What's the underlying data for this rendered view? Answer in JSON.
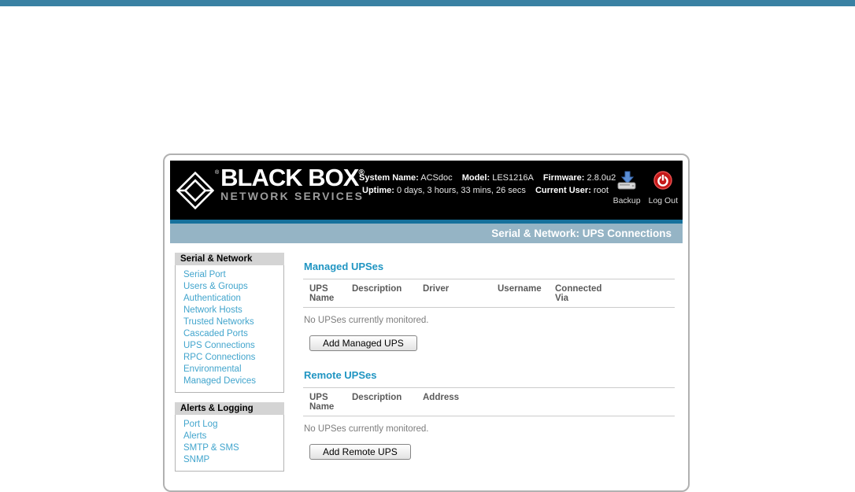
{
  "colors": {
    "topbar": "#3a81a3",
    "banner": "#95b4c5",
    "teal_strip": "#16719c",
    "heading_blue": "#2095c2",
    "link_blue": "#42a5cd",
    "logout_red": "#c41818"
  },
  "header": {
    "brand": {
      "name": "BLACK BOX",
      "reg": "®",
      "tagline": "NETWORK SERVICES",
      "diamond_icon": "brand-diamond-icon"
    },
    "info_line1": [
      {
        "label": "System Name:",
        "value": "ACSdoc"
      },
      {
        "label": "Model:",
        "value": "LES1216A"
      },
      {
        "label": "Firmware:",
        "value": "2.8.0u2"
      }
    ],
    "info_line2": [
      {
        "label": "Uptime:",
        "value": "0 days, 3 hours, 33 mins, 26 secs"
      },
      {
        "label": "Current User:",
        "value": "root"
      }
    ],
    "actions": [
      {
        "label": "Backup",
        "icon": "backup-icon"
      },
      {
        "label": "Log Out",
        "icon": "logout-icon"
      }
    ]
  },
  "banner": {
    "title": "Serial & Network: UPS Connections"
  },
  "sidebar": {
    "sections": [
      {
        "title": "Serial & Network",
        "items": [
          "Serial Port",
          "Users & Groups",
          "Authentication",
          "Network Hosts",
          "Trusted Networks",
          "Cascaded Ports",
          "UPS Connections",
          "RPC Connections",
          "Environmental",
          "Managed Devices"
        ]
      },
      {
        "title": "Alerts & Logging",
        "items": [
          "Port Log",
          "Alerts",
          "SMTP & SMS",
          "SNMP"
        ]
      }
    ]
  },
  "main": {
    "managed": {
      "title": "Managed UPSes",
      "columns": [
        "UPS Name",
        "Description",
        "Driver",
        "Username",
        "Connected Via"
      ],
      "empty": "No UPSes currently monitored.",
      "button": "Add Managed UPS"
    },
    "remote": {
      "title": "Remote UPSes",
      "columns": [
        "UPS Name",
        "Description",
        "Address"
      ],
      "empty": "No UPSes currently monitored.",
      "button": "Add Remote UPS"
    }
  }
}
